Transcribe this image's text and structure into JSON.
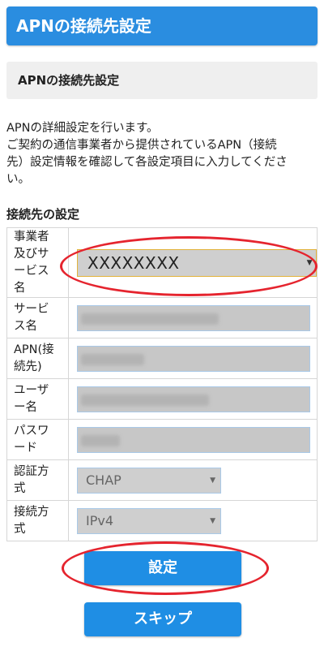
{
  "header": {
    "title": "APNの接続先設定"
  },
  "subheader": {
    "title": "APNの接続先設定"
  },
  "description": {
    "line1": "APNの詳細設定を行います。",
    "line2": "ご契約の通信事業者から提供されているAPN（接続",
    "line3": "先）設定情報を確認して各設定項目に入力してくださ",
    "line4": "い。"
  },
  "section": {
    "title": "接続先の設定"
  },
  "form": {
    "rows": [
      {
        "label_lines": [
          "事業者",
          "及びサ",
          "ービス",
          "名"
        ],
        "value": "XXXXXXXX"
      },
      {
        "label_lines": [
          "サービ",
          "ス名"
        ]
      },
      {
        "label_lines": [
          "APN(接",
          "続先)"
        ]
      },
      {
        "label_lines": [
          "ユーザ",
          "ー名"
        ]
      },
      {
        "label_lines": [
          "パスワ",
          "ード"
        ]
      },
      {
        "label_lines": [
          "認証方",
          "式"
        ],
        "value": "CHAP"
      },
      {
        "label_lines": [
          "接続方",
          "式"
        ],
        "value": "IPv4"
      }
    ]
  },
  "buttons": {
    "settings": "設定",
    "skip": "スキップ"
  },
  "colors": {
    "accent": "#2a8de0",
    "annotation": "#e5242e",
    "select_focus_border": "#e2b23a"
  }
}
